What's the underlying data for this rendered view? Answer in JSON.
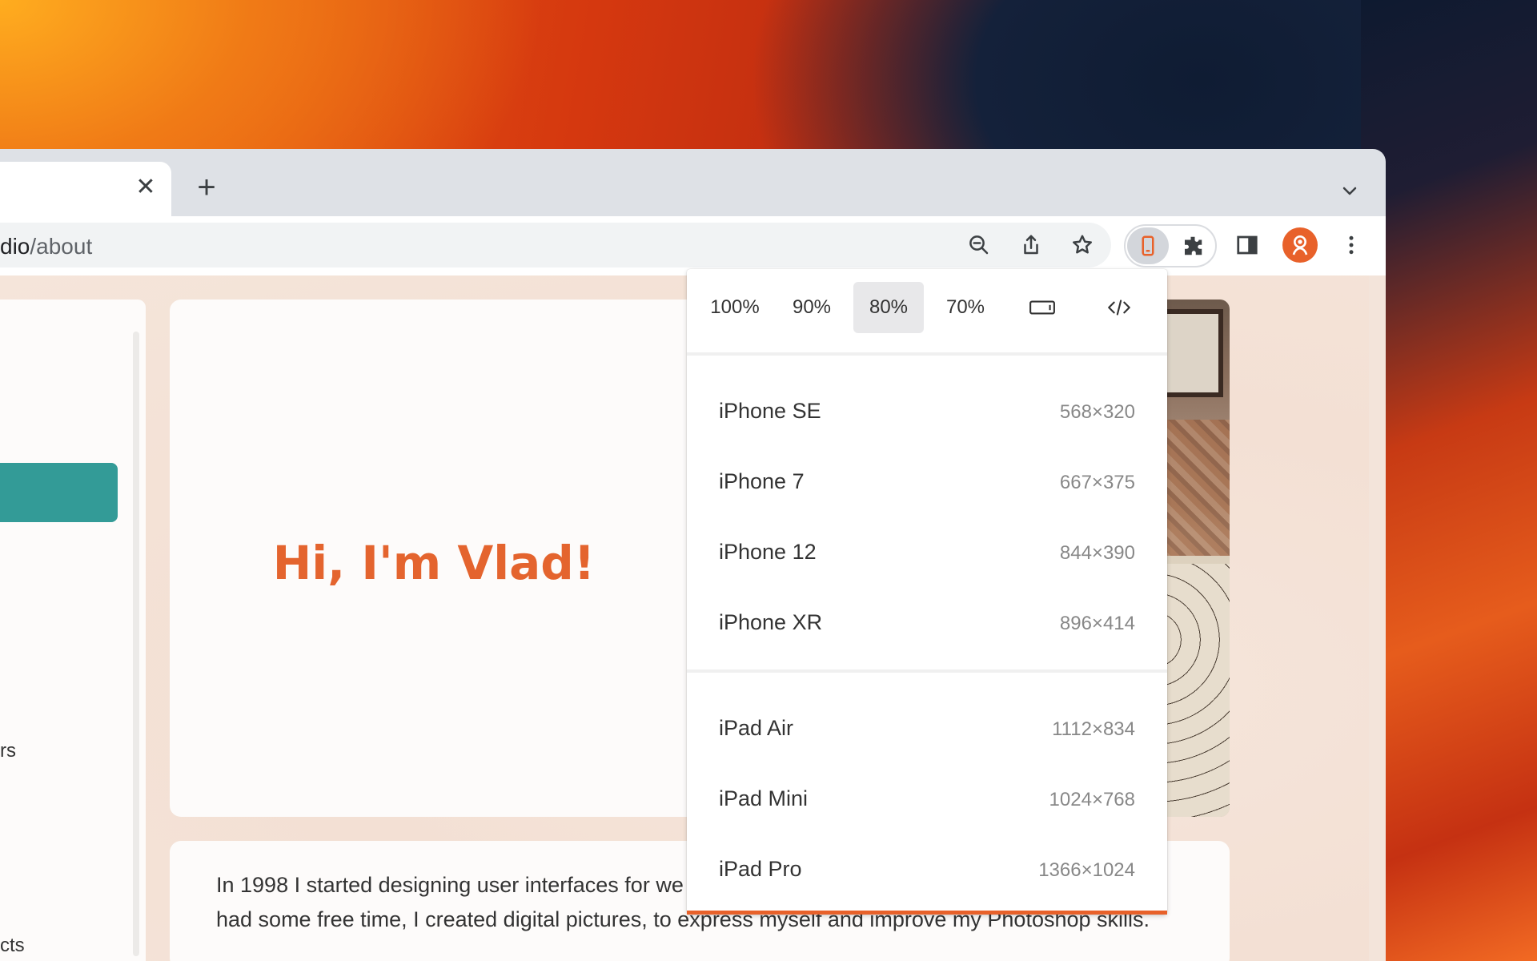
{
  "browser": {
    "url_host": "dio",
    "url_path": "/about",
    "tab_close": "✕",
    "new_tab": "+"
  },
  "toolbar": {
    "icons": [
      "zoom-out-icon",
      "share-icon",
      "star-icon",
      "responsive-icon",
      "extensions-icon",
      "side-panel-icon",
      "avatar-icon",
      "menu-icon"
    ],
    "accent": "#e8612a"
  },
  "sidebar": {
    "partial_texts": [
      "rs",
      "cts"
    ],
    "button_color": "#339b97"
  },
  "hero": {
    "title": "Hi, I'm Vlad!",
    "title_color": "#e4642e"
  },
  "body_text": {
    "line1": "In 1998 I started designing user interfaces for we",
    "line2": "had some free time, I created digital pictures, to express myself and improve my Photoshop skills."
  },
  "popup": {
    "zoom_options": [
      "100%",
      "90%",
      "80%",
      "70%"
    ],
    "selected_zoom": "80%",
    "extra_icons": [
      "landscape-icon",
      "code-icon"
    ],
    "phones": [
      {
        "name": "iPhone SE",
        "size": "568×320"
      },
      {
        "name": "iPhone 7",
        "size": "667×375"
      },
      {
        "name": "iPhone 12",
        "size": "844×390"
      },
      {
        "name": "iPhone XR",
        "size": "896×414"
      }
    ],
    "tablets": [
      {
        "name": "iPad Air",
        "size": "1112×834"
      },
      {
        "name": "iPad Mini",
        "size": "1024×768"
      },
      {
        "name": "iPad Pro",
        "size": "1366×1024"
      }
    ]
  }
}
